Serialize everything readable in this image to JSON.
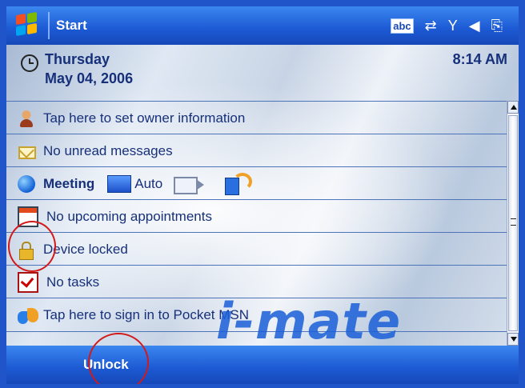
{
  "titlebar": {
    "title": "Start",
    "status_icons": [
      "abc-input-icon",
      "connectivity-icon",
      "signal-icon",
      "volume-icon",
      "battery-icon"
    ],
    "abc_text": "abc"
  },
  "today": {
    "day": "Thursday",
    "date": "May 04, 2006",
    "time": "8:14 AM",
    "rows": [
      {
        "label": "Tap here to set owner information",
        "icon": "owner-icon"
      },
      {
        "label": "No unread messages",
        "icon": "messages-icon"
      },
      {
        "label": "No upcoming appointments",
        "icon": "calendar-icon"
      },
      {
        "label": "Device locked",
        "icon": "lock-icon"
      },
      {
        "label": "No tasks",
        "icon": "tasks-icon"
      },
      {
        "label": "Tap here to sign in to Pocket MSN",
        "icon": "msn-butterfly-icon"
      }
    ],
    "meeting": {
      "profile": "Meeting",
      "auto": "Auto"
    },
    "logo_text": "i-mate"
  },
  "menubar": {
    "left_softkey": "Unlock"
  },
  "colors": {
    "titlebar_blue": "#1c59d3",
    "text_blue": "#17307a",
    "annotation_red": "#d21a1a"
  }
}
